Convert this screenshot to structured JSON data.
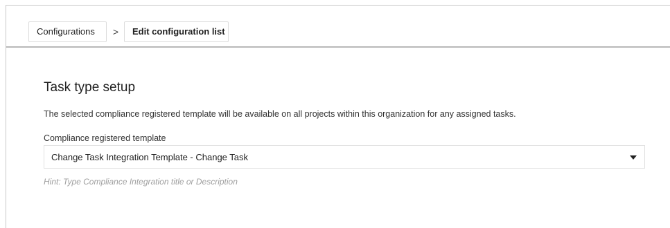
{
  "breadcrumb": {
    "items": [
      {
        "label": "Configurations"
      },
      {
        "label": "Edit configuration list"
      }
    ],
    "separator": ">"
  },
  "section": {
    "title": "Task type setup",
    "description": "The selected compliance registered template will be available on all projects within this organization for any assigned tasks."
  },
  "field": {
    "label": "Compliance registered template",
    "value": "Change Task Integration Template - Change Task",
    "hint": "Hint: Type Compliance Integration title or Description"
  },
  "icons": {
    "dropdown": "caret-down-icon",
    "separator": "chevron-right-icon"
  }
}
